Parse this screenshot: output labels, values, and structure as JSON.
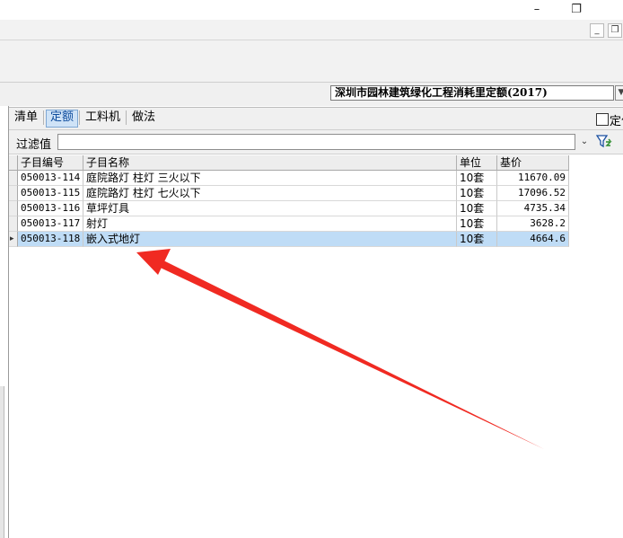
{
  "window": {
    "minimize_glyph": "–",
    "restore_glyph": "❐",
    "mdi_minimize_glyph": "_",
    "mdi_restore_glyph": "❐"
  },
  "quota_selector": {
    "selected": "深圳市园林建筑绿化工程消耗里定额(2017)",
    "dropdown_glyph": "▼"
  },
  "tabs": [
    "清单",
    "定额",
    "工料机",
    "做法"
  ],
  "active_tab": "定额",
  "fixed_option_label": "定位",
  "filter": {
    "label": "过滤值",
    "value": "",
    "chevron_glyph": "⌄"
  },
  "grid": {
    "columns": [
      "子目编号",
      "子目名称",
      "单位",
      "基价"
    ],
    "rows": [
      {
        "code": "050013-114",
        "name": "庭院路灯 柱灯 三火以下",
        "unit": "10套",
        "price": "11670.09"
      },
      {
        "code": "050013-115",
        "name": "庭院路灯 柱灯 七火以下",
        "unit": "10套",
        "price": "17096.52"
      },
      {
        "code": "050013-116",
        "name": "草坪灯具",
        "unit": "10套",
        "price": "4735.34"
      },
      {
        "code": "050013-117",
        "name": "射灯",
        "unit": "10套",
        "price": "3628.2"
      },
      {
        "code": "050013-118",
        "name": "嵌入式地灯",
        "unit": "10套",
        "price": "4664.6"
      }
    ],
    "selected_row_marker": "▸",
    "selected_index": 4
  },
  "colors": {
    "selection": "#bfdcf6",
    "annotation_arrow": "#f02a22",
    "active_tab": "#cfe3f7"
  }
}
